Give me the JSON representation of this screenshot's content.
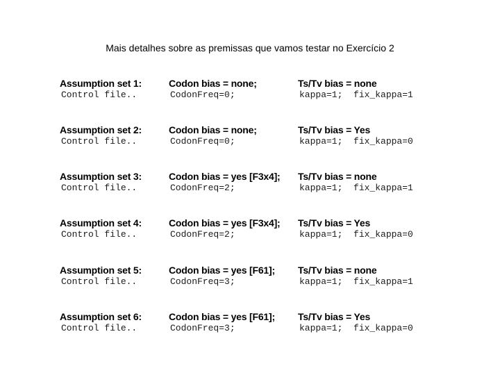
{
  "subtitle": "Mais detalhes sobre as premissas que vamos testar no Exercício 2",
  "sets": [
    {
      "label": "Assumption set 1:",
      "control": "Control file..",
      "codon_head": "Codon bias = none;",
      "codon_code": "CodonFreq=0;",
      "tstv_head": "Ts/Tv bias = none",
      "tstv_code": "kappa=1;  fix_kappa=1"
    },
    {
      "label": "Assumption set 2:",
      "control": "Control file..",
      "codon_head": "Codon bias = none;",
      "codon_code": "CodonFreq=0;",
      "tstv_head": "Ts/Tv bias = Yes",
      "tstv_code": "kappa=1;  fix_kappa=0"
    },
    {
      "label": "Assumption set 3:",
      "control": "Control file..",
      "codon_head": "Codon bias = yes [F3x4];",
      "codon_code": "CodonFreq=2;",
      "tstv_head": "Ts/Tv bias = none",
      "tstv_code": "kappa=1;  fix_kappa=1"
    },
    {
      "label": "Assumption set 4:",
      "control": "Control file..",
      "codon_head": "Codon bias = yes [F3x4];",
      "codon_code": "CodonFreq=2;",
      "tstv_head": "Ts/Tv bias = Yes",
      "tstv_code": "kappa=1;  fix_kappa=0"
    },
    {
      "label": "Assumption set 5:",
      "control": "Control file..",
      "codon_head": "Codon bias = yes [F61];",
      "codon_code": "CodonFreq=3;",
      "tstv_head": "Ts/Tv bias = none",
      "tstv_code": "kappa=1;  fix_kappa=1"
    },
    {
      "label": "Assumption set 6:",
      "control": "Control file..",
      "codon_head": "Codon bias = yes [F61];",
      "codon_code": "CodonFreq=3;",
      "tstv_head": "Ts/Tv bias = Yes",
      "tstv_code": "kappa=1;  fix_kappa=0"
    }
  ]
}
